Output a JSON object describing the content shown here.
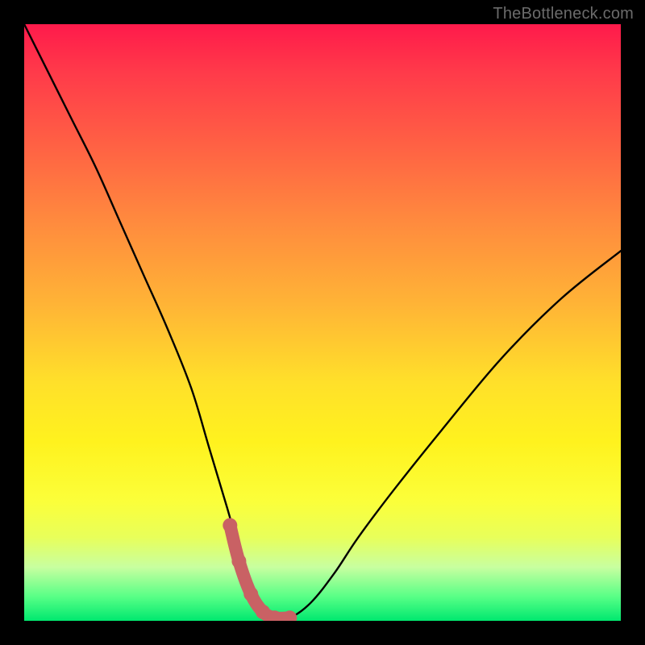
{
  "watermark": "TheBottleneck.com",
  "chart_data": {
    "type": "line",
    "title": "",
    "xlabel": "",
    "ylabel": "",
    "xlim": [
      0,
      100
    ],
    "ylim": [
      0,
      100
    ],
    "series": [
      {
        "name": "bottleneck-curve",
        "x": [
          0,
          4,
          8,
          12,
          16,
          20,
          24,
          28,
          31,
          34,
          36,
          38,
          40,
          42,
          44.5,
          48,
          52,
          56,
          62,
          70,
          80,
          90,
          100
        ],
        "y": [
          100,
          92,
          84,
          76,
          67,
          58,
          49,
          39,
          29,
          19,
          12,
          6,
          2,
          0.5,
          0.5,
          3,
          8,
          14,
          22,
          32,
          44,
          54,
          62
        ]
      },
      {
        "name": "highlight-region",
        "x": [
          34.5,
          36,
          38,
          40,
          42,
          44.5
        ],
        "y": [
          16,
          10,
          4.5,
          1.5,
          0.5,
          0.5
        ]
      }
    ],
    "annotations": []
  },
  "colors": {
    "curve": "#000000",
    "highlight": "#c96164",
    "background_top": "#ff1a4b",
    "background_bottom": "#00e86f",
    "frame": "#000000"
  }
}
